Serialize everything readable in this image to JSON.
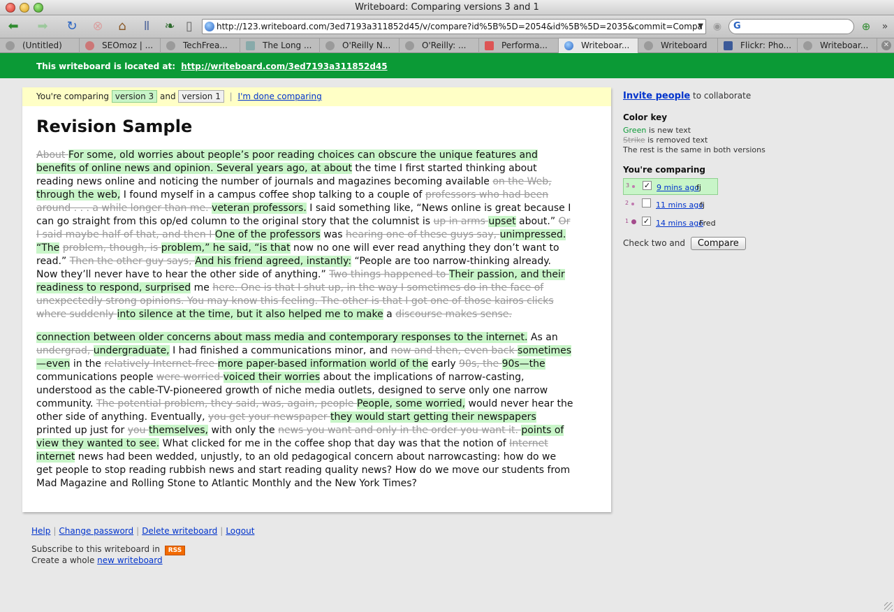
{
  "window": {
    "title": "Writeboard: Comparing versions 3 and 1"
  },
  "toolbar": {
    "url": "http://123.writeboard.com/3ed7193a311852d45/v/compare?id%5B%5D=2054&id%5B%5D=2035&commit=Compa"
  },
  "tabs": [
    {
      "label": "(Untitled)",
      "icon": "globe-gray"
    },
    {
      "label": "SEOmoz | ...",
      "icon": "gear"
    },
    {
      "label": "TechFrea...",
      "icon": "globe-gray"
    },
    {
      "label": "The Long ...",
      "icon": "image"
    },
    {
      "label": "O'Reilly N...",
      "icon": "globe-gray"
    },
    {
      "label": "O'Reilly: ...",
      "icon": "globe-gray"
    },
    {
      "label": "Performa...",
      "icon": "document"
    },
    {
      "label": "Writeboar...",
      "icon": "globe"
    },
    {
      "label": "Writeboard",
      "icon": "globe-gray"
    },
    {
      "label": "Flickr: Pho...",
      "icon": "facebook"
    },
    {
      "label": "Writeboar...",
      "icon": "globe-gray"
    }
  ],
  "banner": {
    "prefix": "This writeboard is located at:",
    "link": "http://writeboard.com/3ed7193a311852d45"
  },
  "compare_bar": {
    "prefix": "You're comparing",
    "version_new": "version 3",
    "and": "and",
    "version_old": "version 1",
    "done": "I'm done comparing"
  },
  "document": {
    "title": "Revision Sample",
    "paragraphs": [
      [
        [
          "d",
          "About "
        ],
        [
          "i",
          "For some, old worries about people’s poor reading choices can obscure the unique features and benefits of online news and opinion. Several years ago, at about"
        ],
        [
          "s",
          " the time I first started thinking about reading news online and noticing the number of journals and magazines becoming available "
        ],
        [
          "d",
          "on the Web, "
        ],
        [
          "i",
          "through the web,"
        ],
        [
          "s",
          " I found myself in a campus coffee shop talking to a couple of "
        ],
        [
          "d",
          "professors who had been around . . . a while longer than me. "
        ],
        [
          "i",
          "veteran professors."
        ],
        [
          "s",
          " I said something like, “News online is great because I can go straight from this op/ed column to the original story that the columnist is "
        ],
        [
          "d",
          "up in arms "
        ],
        [
          "i",
          "upset"
        ],
        [
          "s",
          " about.” "
        ],
        [
          "d",
          "Or I said maybe half of that, and then I "
        ],
        [
          "i",
          "One of the professors"
        ],
        [
          "s",
          " was "
        ],
        [
          "d",
          "hearing one of these guys say, "
        ],
        [
          "i",
          "unimpressed. “The"
        ],
        [
          "s",
          " "
        ],
        [
          "d",
          "problem, though, is "
        ],
        [
          "i",
          "problem,” he said, “is that"
        ],
        [
          "s",
          " now no one will ever read anything they don’t want to read.” "
        ],
        [
          "d",
          "Then the other guy says, "
        ],
        [
          "i",
          "And his friend agreed, instantly:"
        ],
        [
          "s",
          " “People are too narrow-thinking already. Now they’ll never have to hear the other side of anything.” "
        ],
        [
          "d",
          "Two things happened to "
        ],
        [
          "i",
          "Their passion, and their readiness to respond, surprised"
        ],
        [
          "s",
          " me "
        ],
        [
          "d",
          "here. One is that I shut up, in the way I sometimes do in the face of unexpectedly strong opinions. You may know this feeling. The other is that I got one of those kairos clicks where suddenly "
        ],
        [
          "i",
          "into silence at the time, but it also helped me to make"
        ],
        [
          "s",
          " a "
        ],
        [
          "d",
          "discourse makes sense."
        ]
      ],
      [
        [
          "i",
          "connection between older concerns about mass media and contemporary responses to the internet."
        ],
        [
          "s",
          " As an "
        ],
        [
          "d",
          "undergrad, "
        ],
        [
          "i",
          "undergraduate,"
        ],
        [
          "s",
          " I had finished a communications minor, and "
        ],
        [
          "d",
          "now and then, even back "
        ],
        [
          "i",
          "sometimes—even"
        ],
        [
          "s",
          " in the "
        ],
        [
          "d",
          "relatively Internet-free "
        ],
        [
          "i",
          "more paper-based information world of the"
        ],
        [
          "s",
          " early "
        ],
        [
          "d",
          "90s, the "
        ],
        [
          "i",
          "90s—the"
        ],
        [
          "s",
          " communications people "
        ],
        [
          "d",
          "were worried "
        ],
        [
          "i",
          "voiced their worries"
        ],
        [
          "s",
          " about the implications of narrow-casting, understood as the cable-TV-pioneered growth of niche media outlets, designed to serve only one narrow community. "
        ],
        [
          "d",
          "The potential problem, they said, was, again, people "
        ],
        [
          "i",
          "People, some worried,"
        ],
        [
          "s",
          " would never hear the other side of anything. Eventually, "
        ],
        [
          "d",
          "you get your newspaper "
        ],
        [
          "i",
          "they would start getting their newspapers"
        ],
        [
          "s",
          " printed up just for "
        ],
        [
          "d",
          "you "
        ],
        [
          "i",
          "themselves,"
        ],
        [
          "s",
          " with only the "
        ],
        [
          "d",
          "news you want and only in the order you want it. "
        ],
        [
          "i",
          "points of view they wanted to see."
        ],
        [
          "s",
          " What clicked for me in the coffee shop that day was that the notion of "
        ],
        [
          "d",
          "Internet "
        ],
        [
          "i",
          "internet"
        ],
        [
          "s",
          " news had been wedded, unjustly, to an old pedagogical concern about narrowcasting: how do we get people to stop reading rubbish news and start reading quality news? How do we move our students from Mad Magazine and Rolling Stone to Atlantic Monthly and the New York Times?"
        ]
      ]
    ]
  },
  "sidebar": {
    "invite_link": "Invite people",
    "invite_suffix": "to collaborate",
    "color_key_heading": "Color key",
    "key_green": "Green",
    "key_green_rest": "is new text",
    "key_strike": "Strike",
    "key_strike_rest": "is removed text",
    "key_same": "The rest is the same in both versions",
    "comparing_heading": "You're comparing",
    "versions": [
      {
        "num": "3",
        "time": "9 mins ago",
        "user": "fj",
        "checked": true,
        "selected": true
      },
      {
        "num": "2",
        "time": "11 mins ago",
        "user": "fj",
        "checked": false,
        "selected": false
      },
      {
        "num": "1",
        "time": "14 mins ago",
        "user": "Fred",
        "checked": true,
        "selected": false
      }
    ],
    "check_two": "Check two and",
    "compare_button": "Compare"
  },
  "footer": {
    "links": [
      "Help",
      "Change password",
      "Delete writeboard",
      "Logout"
    ],
    "subscribe_prefix": "Subscribe to this writeboard in",
    "rss": "RSS",
    "create_prefix": "Create a whole",
    "create_link": "new writeboard"
  },
  "colors": {
    "banner": "#0b9a36",
    "inserted_bg": "#c8f5c8",
    "compare_bar_bg": "#ffffc6",
    "link": "#0033cc"
  }
}
